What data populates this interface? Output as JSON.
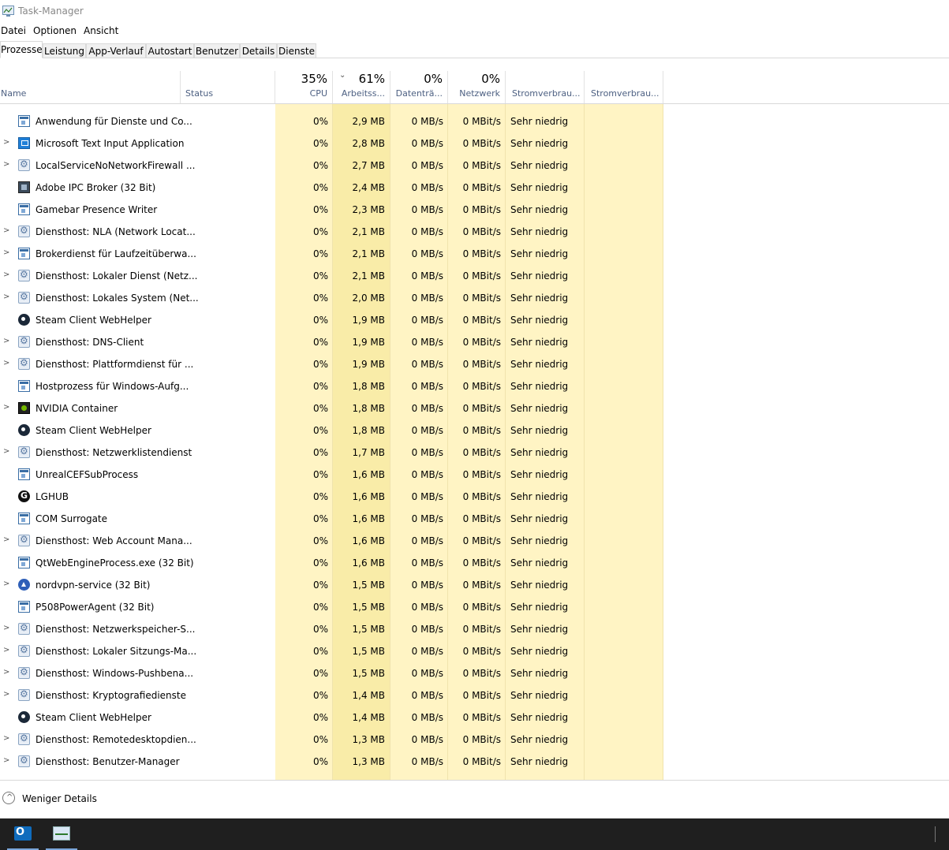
{
  "window": {
    "title": "Task-Manager"
  },
  "menu": [
    "Datei",
    "Optionen",
    "Ansicht"
  ],
  "tabs": [
    {
      "label": "Prozesse",
      "active": true
    },
    {
      "label": "Leistung",
      "active": false
    },
    {
      "label": "App-Verlauf",
      "active": false
    },
    {
      "label": "Autostart",
      "active": false
    },
    {
      "label": "Benutzer",
      "active": false
    },
    {
      "label": "Details",
      "active": false
    },
    {
      "label": "Dienste",
      "active": false
    }
  ],
  "columns": {
    "name": {
      "label": "Name"
    },
    "status": {
      "label": "Status"
    },
    "cpu": {
      "label": "CPU",
      "pct": "35%"
    },
    "memory": {
      "label": "Arbeitss...",
      "pct": "61%"
    },
    "disk": {
      "label": "Datenträ...",
      "pct": "0%"
    },
    "network": {
      "label": "Netzwerk",
      "pct": "0%"
    },
    "power": {
      "label": "Stromverbrau..."
    },
    "power_trend": {
      "label": "Stromverbrau..."
    }
  },
  "processes": [
    {
      "name": "Anwendung für Dienste und Co...",
      "icon": "window-icon",
      "expand": false,
      "cpu": "0%",
      "mem": "2,9 MB",
      "disk": "0 MB/s",
      "net": "0 MBit/s",
      "power": "Sehr niedrig"
    },
    {
      "name": "Microsoft Text Input Application",
      "icon": "blue-app-icon",
      "expand": true,
      "cpu": "0%",
      "mem": "2,8 MB",
      "disk": "0 MB/s",
      "net": "0 MBit/s",
      "power": "Sehr niedrig"
    },
    {
      "name": "LocalServiceNoNetworkFirewall ...",
      "icon": "gear-icon",
      "expand": true,
      "cpu": "0%",
      "mem": "2,7 MB",
      "disk": "0 MB/s",
      "net": "0 MBit/s",
      "power": "Sehr niedrig"
    },
    {
      "name": "Adobe IPC Broker (32 Bit)",
      "icon": "adobe-icon",
      "expand": false,
      "cpu": "0%",
      "mem": "2,4 MB",
      "disk": "0 MB/s",
      "net": "0 MBit/s",
      "power": "Sehr niedrig"
    },
    {
      "name": "Gamebar Presence Writer",
      "icon": "window-icon",
      "expand": false,
      "cpu": "0%",
      "mem": "2,3 MB",
      "disk": "0 MB/s",
      "net": "0 MBit/s",
      "power": "Sehr niedrig"
    },
    {
      "name": "Diensthost: NLA (Network Locat...",
      "icon": "gear-icon",
      "expand": true,
      "cpu": "0%",
      "mem": "2,1 MB",
      "disk": "0 MB/s",
      "net": "0 MBit/s",
      "power": "Sehr niedrig"
    },
    {
      "name": "Brokerdienst für Laufzeitüberwa...",
      "icon": "window-icon",
      "expand": true,
      "cpu": "0%",
      "mem": "2,1 MB",
      "disk": "0 MB/s",
      "net": "0 MBit/s",
      "power": "Sehr niedrig"
    },
    {
      "name": "Diensthost: Lokaler Dienst (Netz...",
      "icon": "gear-icon",
      "expand": true,
      "cpu": "0%",
      "mem": "2,1 MB",
      "disk": "0 MB/s",
      "net": "0 MBit/s",
      "power": "Sehr niedrig"
    },
    {
      "name": "Diensthost: Lokales System (Net...",
      "icon": "gear-icon",
      "expand": true,
      "cpu": "0%",
      "mem": "2,0 MB",
      "disk": "0 MB/s",
      "net": "0 MBit/s",
      "power": "Sehr niedrig"
    },
    {
      "name": "Steam Client WebHelper",
      "icon": "steam-icon",
      "expand": false,
      "cpu": "0%",
      "mem": "1,9 MB",
      "disk": "0 MB/s",
      "net": "0 MBit/s",
      "power": "Sehr niedrig"
    },
    {
      "name": "Diensthost: DNS-Client",
      "icon": "gear-icon",
      "expand": true,
      "cpu": "0%",
      "mem": "1,9 MB",
      "disk": "0 MB/s",
      "net": "0 MBit/s",
      "power": "Sehr niedrig"
    },
    {
      "name": "Diensthost: Plattformdienst für ...",
      "icon": "gear-icon",
      "expand": true,
      "cpu": "0%",
      "mem": "1,9 MB",
      "disk": "0 MB/s",
      "net": "0 MBit/s",
      "power": "Sehr niedrig"
    },
    {
      "name": "Hostprozess für Windows-Aufg...",
      "icon": "window-icon",
      "expand": false,
      "cpu": "0%",
      "mem": "1,8 MB",
      "disk": "0 MB/s",
      "net": "0 MBit/s",
      "power": "Sehr niedrig"
    },
    {
      "name": "NVIDIA Container",
      "icon": "nvidia-icon",
      "expand": true,
      "cpu": "0%",
      "mem": "1,8 MB",
      "disk": "0 MB/s",
      "net": "0 MBit/s",
      "power": "Sehr niedrig"
    },
    {
      "name": "Steam Client WebHelper",
      "icon": "steam-icon",
      "expand": false,
      "cpu": "0%",
      "mem": "1,8 MB",
      "disk": "0 MB/s",
      "net": "0 MBit/s",
      "power": "Sehr niedrig"
    },
    {
      "name": "Diensthost: Netzwerklistendienst",
      "icon": "gear-icon",
      "expand": true,
      "cpu": "0%",
      "mem": "1,7 MB",
      "disk": "0 MB/s",
      "net": "0 MBit/s",
      "power": "Sehr niedrig"
    },
    {
      "name": "UnrealCEFSubProcess",
      "icon": "window-icon",
      "expand": false,
      "cpu": "0%",
      "mem": "1,6 MB",
      "disk": "0 MB/s",
      "net": "0 MBit/s",
      "power": "Sehr niedrig"
    },
    {
      "name": "LGHUB",
      "icon": "logitech-icon",
      "expand": false,
      "cpu": "0%",
      "mem": "1,6 MB",
      "disk": "0 MB/s",
      "net": "0 MBit/s",
      "power": "Sehr niedrig"
    },
    {
      "name": "COM Surrogate",
      "icon": "window-icon",
      "expand": false,
      "cpu": "0%",
      "mem": "1,6 MB",
      "disk": "0 MB/s",
      "net": "0 MBit/s",
      "power": "Sehr niedrig"
    },
    {
      "name": "Diensthost: Web Account Mana...",
      "icon": "gear-icon",
      "expand": true,
      "cpu": "0%",
      "mem": "1,6 MB",
      "disk": "0 MB/s",
      "net": "0 MBit/s",
      "power": "Sehr niedrig"
    },
    {
      "name": "QtWebEngineProcess.exe (32 Bit)",
      "icon": "window-icon",
      "expand": false,
      "cpu": "0%",
      "mem": "1,6 MB",
      "disk": "0 MB/s",
      "net": "0 MBit/s",
      "power": "Sehr niedrig"
    },
    {
      "name": "nordvpn-service (32 Bit)",
      "icon": "nordvpn-icon",
      "expand": true,
      "cpu": "0%",
      "mem": "1,5 MB",
      "disk": "0 MB/s",
      "net": "0 MBit/s",
      "power": "Sehr niedrig"
    },
    {
      "name": "P508PowerAgent (32 Bit)",
      "icon": "window-icon",
      "expand": false,
      "cpu": "0%",
      "mem": "1,5 MB",
      "disk": "0 MB/s",
      "net": "0 MBit/s",
      "power": "Sehr niedrig"
    },
    {
      "name": "Diensthost: Netzwerkspeicher-S...",
      "icon": "gear-icon",
      "expand": true,
      "cpu": "0%",
      "mem": "1,5 MB",
      "disk": "0 MB/s",
      "net": "0 MBit/s",
      "power": "Sehr niedrig"
    },
    {
      "name": "Diensthost: Lokaler Sitzungs-Ma...",
      "icon": "gear-icon",
      "expand": true,
      "cpu": "0%",
      "mem": "1,5 MB",
      "disk": "0 MB/s",
      "net": "0 MBit/s",
      "power": "Sehr niedrig"
    },
    {
      "name": "Diensthost: Windows-Pushbena...",
      "icon": "gear-icon",
      "expand": true,
      "cpu": "0%",
      "mem": "1,5 MB",
      "disk": "0 MB/s",
      "net": "0 MBit/s",
      "power": "Sehr niedrig"
    },
    {
      "name": "Diensthost: Kryptografiedienste",
      "icon": "gear-icon",
      "expand": true,
      "cpu": "0%",
      "mem": "1,4 MB",
      "disk": "0 MB/s",
      "net": "0 MBit/s",
      "power": "Sehr niedrig"
    },
    {
      "name": "Steam Client WebHelper",
      "icon": "steam-icon",
      "expand": false,
      "cpu": "0%",
      "mem": "1,4 MB",
      "disk": "0 MB/s",
      "net": "0 MBit/s",
      "power": "Sehr niedrig"
    },
    {
      "name": "Diensthost: Remotedesktopdien...",
      "icon": "gear-icon",
      "expand": true,
      "cpu": "0%",
      "mem": "1,3 MB",
      "disk": "0 MB/s",
      "net": "0 MBit/s",
      "power": "Sehr niedrig"
    },
    {
      "name": "Diensthost: Benutzer-Manager",
      "icon": "gear-icon",
      "expand": true,
      "cpu": "0%",
      "mem": "1,3 MB",
      "disk": "0 MB/s",
      "net": "0 MBit/s",
      "power": "Sehr niedrig"
    }
  ],
  "footer": {
    "fewer_details": "Weniger Details"
  },
  "taskbar": {
    "items": [
      "outlook-icon",
      "task-manager-icon"
    ]
  }
}
